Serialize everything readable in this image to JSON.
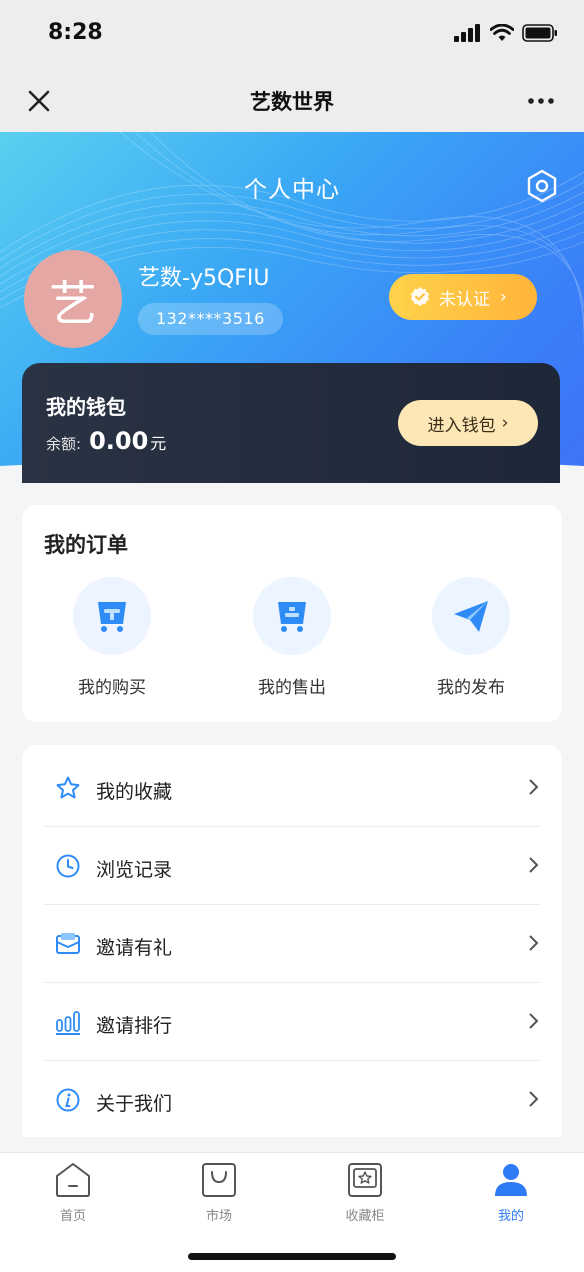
{
  "status_bar": {
    "time": "8:28"
  },
  "nav": {
    "title": "艺数世界"
  },
  "hero": {
    "title": "个人中心"
  },
  "user": {
    "avatar_char": "艺",
    "name": "艺数-y5QFIU",
    "phone": "132****3516",
    "verify_label": "未认证"
  },
  "wallet": {
    "title": "我的钱包",
    "balance_label": "余额:",
    "amount": "0.00",
    "unit": "元",
    "enter_label": "进入钱包"
  },
  "orders": {
    "title": "我的订单",
    "items": [
      {
        "label": "我的购买",
        "icon": "cart-icon"
      },
      {
        "label": "我的售出",
        "icon": "cart-icon"
      },
      {
        "label": "我的发布",
        "icon": "paper-plane-icon"
      }
    ]
  },
  "menu": {
    "items": [
      {
        "label": "我的收藏",
        "icon": "star-icon"
      },
      {
        "label": "浏览记录",
        "icon": "clock-icon"
      },
      {
        "label": "邀请有礼",
        "icon": "envelope-icon"
      },
      {
        "label": "邀请排行",
        "icon": "bar-chart-icon"
      },
      {
        "label": "关于我们",
        "icon": "info-icon"
      }
    ]
  },
  "tabs": [
    {
      "label": "首页",
      "icon": "home-icon",
      "active": false
    },
    {
      "label": "市场",
      "icon": "bag-icon",
      "active": false
    },
    {
      "label": "收藏柜",
      "icon": "cabinet-icon",
      "active": false
    },
    {
      "label": "我的",
      "icon": "user-icon",
      "active": true
    }
  ],
  "colors": {
    "accent": "#2f7bf6",
    "wallet_bg": "#1e2738",
    "verify": "#ffc23f"
  }
}
